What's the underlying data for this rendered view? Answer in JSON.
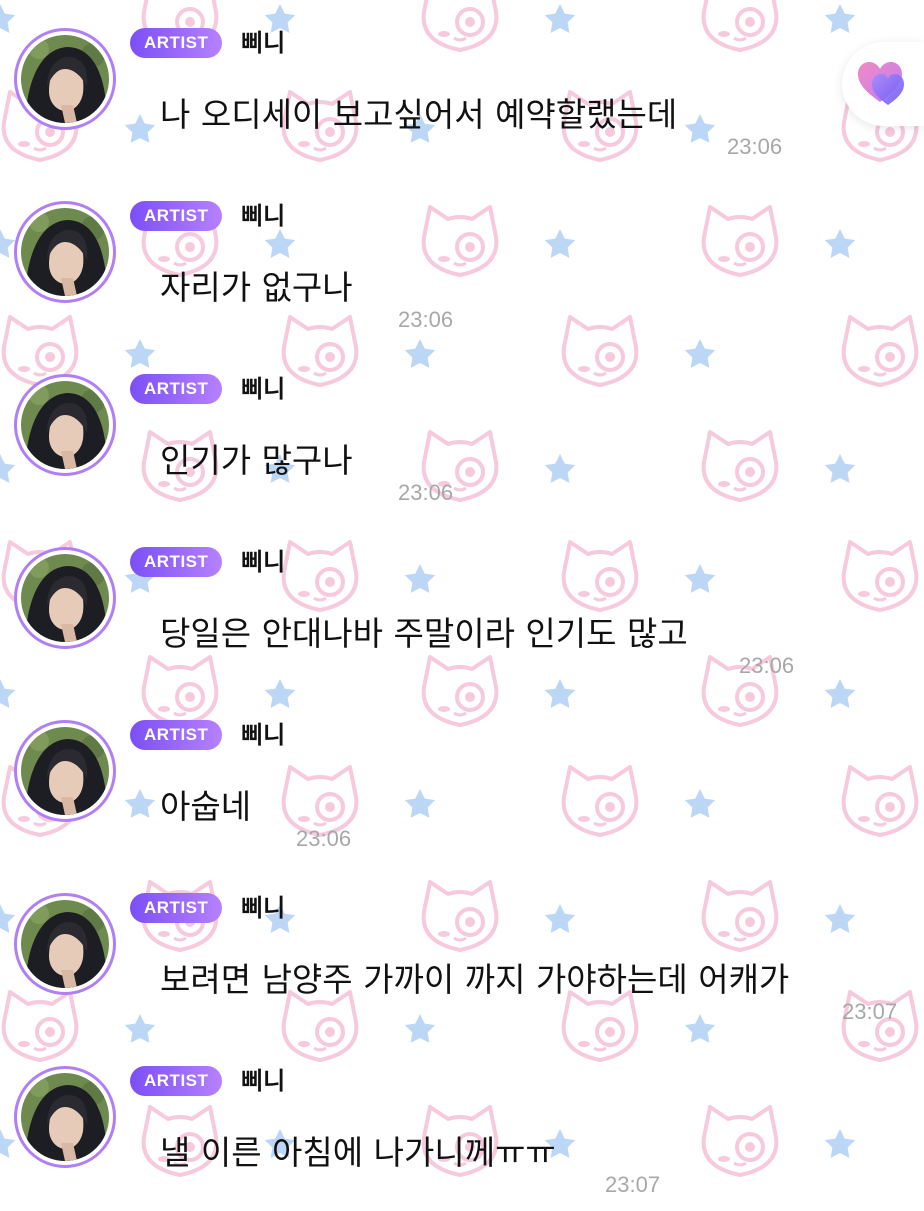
{
  "badge_label": "ARTIST",
  "sender_name": "삐니",
  "messages": [
    {
      "text": "나 오디세이 보고싶어서 예약할랬는데",
      "time": "23:06"
    },
    {
      "text": "자리가 없구나",
      "time": "23:06"
    },
    {
      "text": "인기가 많구나",
      "time": "23:06"
    },
    {
      "text": "당일은 안대나바 주말이라 인기도 많고",
      "time": "23:06"
    },
    {
      "text": "아숩네",
      "time": "23:06"
    },
    {
      "text": "보려면 남양주 가까이 까지 가야하는데 어캐가",
      "time": "23:07"
    },
    {
      "text": "낼 이른 아침에 나가니께ㅠㅠ",
      "time": "23:07"
    }
  ],
  "icons": {
    "like": "heart-icon",
    "background_pattern": [
      "cat-face-icon",
      "star-icon"
    ]
  },
  "colors": {
    "badge_start": "#7b4ff5",
    "badge_end": "#b681ff",
    "avatar_ring": "#b07ef5",
    "timestamp": "#a8a8a8",
    "pattern_pink": "#f7c9dd",
    "pattern_blue": "#bcd6f5"
  }
}
